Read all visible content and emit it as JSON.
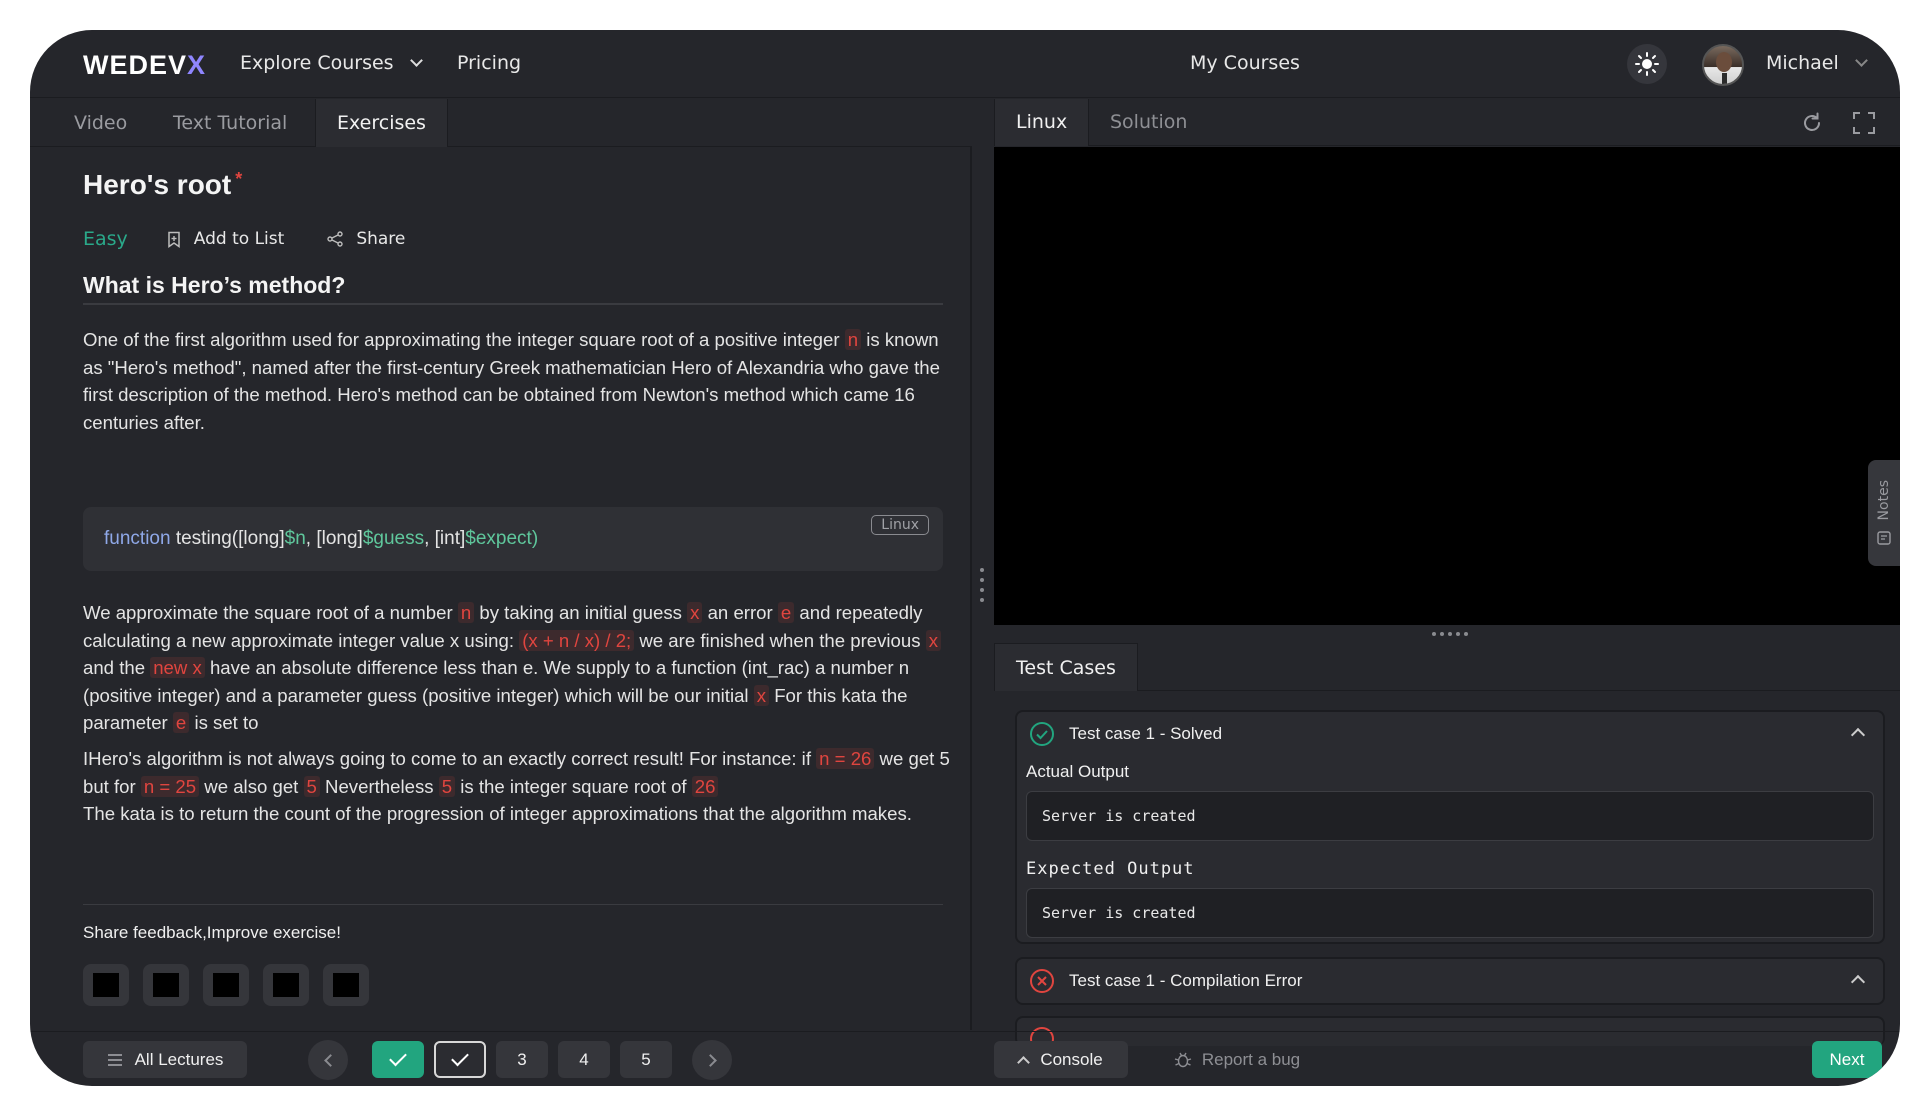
{
  "nav": {
    "logo_main": "WEDEV",
    "logo_x": "X",
    "explore": "Explore Courses",
    "pricing": "Pricing",
    "my_courses": "My Courses",
    "user": "Michael"
  },
  "left_tabs": {
    "video": "Video",
    "text": "Text Tutorial",
    "exercises": "Exercises"
  },
  "exercise": {
    "title": "Hero's root",
    "required_mark": "*",
    "difficulty": "Easy",
    "add_to_list": "Add to List",
    "share": "Share",
    "heading": "What is Hero’s method?",
    "p1": {
      "a": "One of the first algorithm used for approximating the integer square root of a positive integer",
      "n": "n",
      "b": "is known as \"Hero's method\", named after the first-century Greek mathematician Hero of Alexandria who gave the first description of the method. Hero's method can be obtained from Newton's method which came 16 centuries after."
    },
    "code": {
      "keyword": "function",
      "name": "testing([long]",
      "v1": "$n",
      "sep1": ", [long]",
      "v2": "$guess",
      "sep2": ", [int]",
      "v3": "$expect)",
      "lang": "Linux"
    },
    "p2": {
      "a": "We approximate the square root of a number",
      "n": "n",
      "b": "by taking an initial guess",
      "x1": "x",
      "c": "an error",
      "e1": "e",
      "d": "and repeatedly calculating a new approximate integer value x using:",
      "formula": "(x + n / x) / 2;",
      "f": "we are finished when the previous",
      "x2": "x",
      "g": "and the",
      "newx": "new x",
      "h": "have an absolute difference less than e. We supply to a function (int_rac) a number n (positive integer) and a parameter guess (positive integer) which will be our initial",
      "x3": "x",
      "i": "For this kata the parameter",
      "e2": "e",
      "j": "is set to"
    },
    "p3": {
      "a": "IHero's algorithm is not always going to come to an exactly correct result! For instance: if",
      "n26": "n = 26",
      "b": "we get 5 but for",
      "n25": "n = 25",
      "c": "we also get",
      "five1": "5",
      "d": "Nevertheless",
      "five2": "5",
      "e": "is the integer square root of",
      "v26": "26",
      "f": "The kata is to return the count of the progression of integer approximations that the algorithm makes."
    },
    "feedback": "Share feedback,Improve exercise!"
  },
  "right_tabs": {
    "linux": "Linux",
    "solution": "Solution"
  },
  "notes": "Notes",
  "test_cases": {
    "tab": "Test Cases",
    "case1": {
      "title": "Test case 1 - Solved",
      "actual_label": "Actual Output",
      "actual": "Server is created",
      "expected_label": "Expected Output",
      "expected": "Server is created"
    },
    "case2": {
      "title": "Test case 1 - Compilation Error"
    }
  },
  "bottom": {
    "all_lectures": "All Lectures",
    "pages": [
      "3",
      "4",
      "5"
    ],
    "console": "Console",
    "report": "Report a bug",
    "next": "Next"
  },
  "colors": {
    "accent_green": "#22a57f",
    "error_red": "#e0453f",
    "logo_x": "#8f86ff"
  }
}
